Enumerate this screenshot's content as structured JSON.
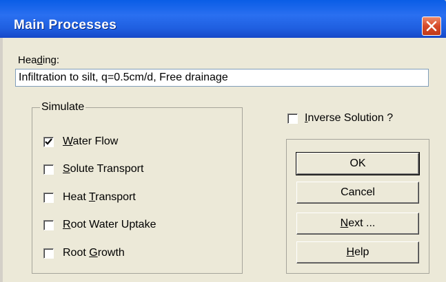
{
  "window": {
    "title": "Main Processes",
    "close_icon": "close-icon"
  },
  "heading": {
    "label_pre": "Hea",
    "label_accel": "d",
    "label_post": "ing:",
    "value": "Infiltration to silt, q=0.5cm/d, Free drainage"
  },
  "simulate": {
    "legend": "Simulate",
    "items": [
      {
        "pre": "",
        "accel": "W",
        "post": "ater Flow",
        "checked": true
      },
      {
        "pre": "",
        "accel": "S",
        "post": "olute Transport",
        "checked": false
      },
      {
        "pre": "Heat ",
        "accel": "T",
        "post": "ransport",
        "checked": false
      },
      {
        "pre": "",
        "accel": "R",
        "post": "oot Water Uptake",
        "checked": false
      },
      {
        "pre": "Root ",
        "accel": "G",
        "post": "rowth",
        "checked": false
      }
    ]
  },
  "inverse": {
    "pre": "",
    "accel": "I",
    "post": "nverse Solution ?",
    "checked": false
  },
  "buttons": {
    "ok": "OK",
    "cancel": "Cancel",
    "next_accel": "N",
    "next_post": "ext ...",
    "help_accel": "H",
    "help_post": "elp"
  }
}
